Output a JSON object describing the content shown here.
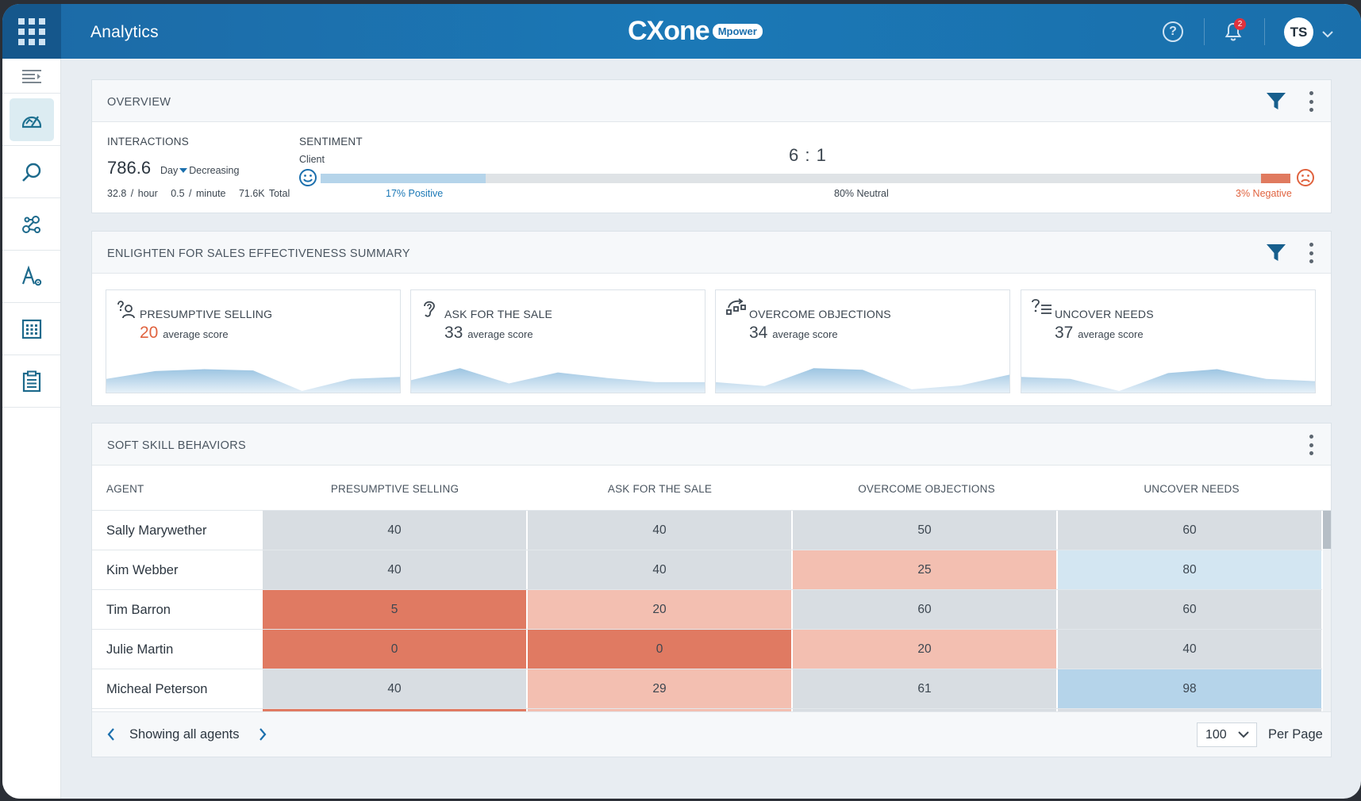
{
  "app": {
    "title": "Analytics",
    "logo_main": "CXone",
    "logo_badge": "Mpower"
  },
  "header": {
    "notification_count": "2",
    "user_initials": "TS"
  },
  "sidebar": {
    "items": [
      "menu-toggle",
      "analytics",
      "search",
      "interactions",
      "text-analysis",
      "reports",
      "forms"
    ]
  },
  "overview": {
    "title": "OVERVIEW",
    "interactions": {
      "label": "INTERACTIONS",
      "value": "786.6",
      "period": "Day",
      "trend": "Decreasing",
      "per_hour": "32.8 / hour",
      "per_minute": "0.5 / minute",
      "total": "71.6K Total"
    },
    "sentiment": {
      "label": "SENTIMENT",
      "sub": "Client",
      "ratio": "6 : 1",
      "positive_pct": 17,
      "neutral_pct": 80,
      "negative_pct": 3,
      "positive_label": "17% Positive",
      "neutral_label": "80% Neutral",
      "negative_label": "3% Negative"
    }
  },
  "summary": {
    "title": "ENLIGHTEN FOR SALES EFFECTIVENESS SUMMARY",
    "tiles": [
      {
        "name": "PRESUMPTIVE SELLING",
        "score": "20",
        "sub": "average score",
        "low": true,
        "trend": [
          0.42,
          0.66,
          0.72,
          0.68,
          0.05,
          0.42,
          0.48
        ]
      },
      {
        "name": "ASK FOR THE SALE",
        "score": "33",
        "sub": "average score",
        "low": false,
        "trend": [
          0.38,
          0.75,
          0.28,
          0.62,
          0.45,
          0.32,
          0.32
        ]
      },
      {
        "name": "OVERCOME OBJECTIONS",
        "score": "34",
        "sub": "average score",
        "low": false,
        "trend": [
          0.32,
          0.2,
          0.75,
          0.7,
          0.1,
          0.22,
          0.55
        ]
      },
      {
        "name": "UNCOVER NEEDS",
        "score": "37",
        "sub": "average score",
        "low": false,
        "trend": [
          0.48,
          0.42,
          0.05,
          0.6,
          0.72,
          0.42,
          0.35
        ]
      }
    ],
    "colors": {
      "spark_fill_top": "#9dc5e2",
      "spark_fill_bottom": "#e6f0f8"
    }
  },
  "table": {
    "title": "SOFT SKILL BEHAVIORS",
    "columns": [
      "AGENT",
      "PRESUMPTIVE SELLING",
      "ASK FOR THE SALE",
      "OVERCOME OBJECTIONS",
      "UNCOVER NEEDS"
    ],
    "rows": [
      {
        "agent": "Sally Marywether",
        "values": [
          "40",
          "40",
          "50",
          "60"
        ]
      },
      {
        "agent": "Kim Webber",
        "values": [
          "40",
          "40",
          "25",
          "80"
        ]
      },
      {
        "agent": "Tim Barron",
        "values": [
          "5",
          "20",
          "60",
          "60"
        ]
      },
      {
        "agent": "Julie Martin",
        "values": [
          "0",
          "0",
          "20",
          "40"
        ]
      },
      {
        "agent": "Micheal Peterson",
        "values": [
          "40",
          "29",
          "61",
          "98"
        ]
      },
      {
        "agent": "",
        "values": [
          "",
          "",
          "",
          ""
        ]
      }
    ],
    "partial_row_colors": [
      "#e07a62",
      "#f3bfb1",
      "#d8dde2",
      "#d8dde2"
    ],
    "colors": {
      "very_low": "#e07a62",
      "low": "#f3bfb1",
      "mid": "#d8dde2",
      "high": "#d3e6f2",
      "very_high": "#b5d4ea"
    },
    "footer": {
      "pager_text": "Showing all agents",
      "per_page_value": "100",
      "per_page_label": "Per Page"
    }
  }
}
